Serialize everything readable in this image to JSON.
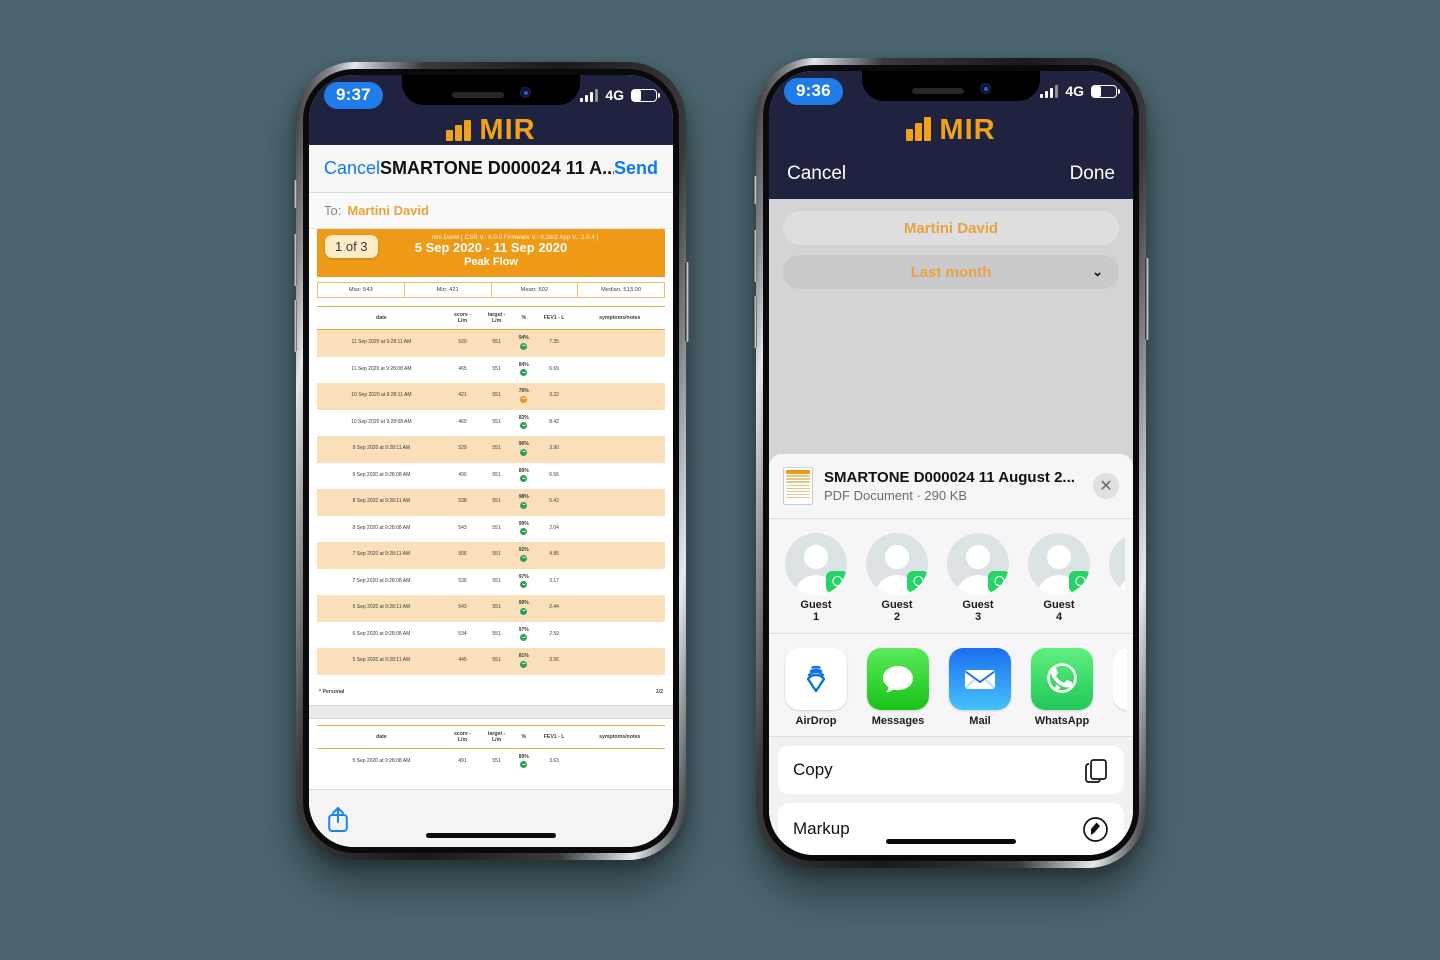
{
  "background_color": "#4b666f",
  "left_phone": {
    "status_bar": {
      "time": "9:37",
      "network": "4G",
      "battery_icon": "battery-icon",
      "signal_icon": "cellular-bars-icon"
    },
    "brand": {
      "word": "MIR",
      "logo_name": "mir-logo-mark",
      "color": "#f0a21c"
    },
    "nav": {
      "cancel": "Cancel",
      "title": "SMARTONE D000024 11 A...",
      "send": "Send"
    },
    "to_field": {
      "label": "To:",
      "value": "Martini David"
    },
    "pdf": {
      "page_badge": "1 of 3",
      "meta": "rtini David  [ CSR V.: 6.0.0 Firmware V.: 0.26r2 App V.: 2.0.4 ]",
      "date_range": "5 Sep 2020 - 11 Sep 2020",
      "test_type": "Peak Flow",
      "stats": [
        "Max: 543",
        "Min: 421",
        "Mean: 502",
        "Median: 513.00"
      ],
      "columns": [
        "date",
        "score - L/m",
        "target - L/m",
        "%",
        "FEV1 - L",
        "symptoms/notes"
      ],
      "rows": [
        {
          "date": "11 Sep 2020 at 9:28:11 AM",
          "score": "520",
          "target": "551",
          "pct": "94%",
          "face": "green",
          "fev1": "7.35",
          "notes": ""
        },
        {
          "date": "11 Sep 2020 at 9:28:08 AM",
          "score": "465",
          "target": "551",
          "pct": "84%",
          "face": "green",
          "fev1": "6.69",
          "notes": ""
        },
        {
          "date": "10 Sep 2020 at 9:28:11 AM",
          "score": "421",
          "target": "551",
          "pct": "76%",
          "face": "orange",
          "fev1": "3.22",
          "notes": ""
        },
        {
          "date": "10 Sep 2020 at 9:28:08 AM",
          "score": "460",
          "target": "551",
          "pct": "83%",
          "face": "green",
          "fev1": "8.42",
          "notes": ""
        },
        {
          "date": "9 Sep 2020 at 9:28:11 AM",
          "score": "529",
          "target": "551",
          "pct": "96%",
          "face": "green",
          "fev1": "3.90",
          "notes": ""
        },
        {
          "date": "9 Sep 2020 at 9:28:08 AM",
          "score": "490",
          "target": "551",
          "pct": "89%",
          "face": "green",
          "fev1": "6.56",
          "notes": ""
        },
        {
          "date": "8 Sep 2020 at 9:28:11 AM",
          "score": "538",
          "target": "551",
          "pct": "98%",
          "face": "green",
          "fev1": "5.42",
          "notes": ""
        },
        {
          "date": "8 Sep 2020 at 9:28:08 AM",
          "score": "543",
          "target": "551",
          "pct": "99%",
          "face": "green",
          "fev1": "2.04",
          "notes": ""
        },
        {
          "date": "7 Sep 2020 at 9:28:11 AM",
          "score": "506",
          "target": "551",
          "pct": "92%",
          "face": "green",
          "fev1": "4.85",
          "notes": ""
        },
        {
          "date": "7 Sep 2020 at 9:28:08 AM",
          "score": "536",
          "target": "551",
          "pct": "97%",
          "face": "green",
          "fev1": "3.17",
          "notes": ""
        },
        {
          "date": "6 Sep 2020 at 9:28:11 AM",
          "score": "543",
          "target": "551",
          "pct": "99%",
          "face": "green",
          "fev1": "2.44",
          "notes": ""
        },
        {
          "date": "6 Sep 2020 at 9:28:08 AM",
          "score": "534",
          "target": "551",
          "pct": "97%",
          "face": "green",
          "fev1": "2.59",
          "notes": ""
        },
        {
          "date": "5 Sep 2020 at 9:28:11 AM",
          "score": "445",
          "target": "551",
          "pct": "81%",
          "face": "green",
          "fev1": "3.56",
          "notes": ""
        }
      ],
      "footnote": "* Personal",
      "page_number": "1/2",
      "page2_rows": [
        {
          "date": "5 Sep 2020 at 9:28:08 AM",
          "score": "491",
          "target": "551",
          "pct": "89%",
          "face": "green",
          "fev1": "3.63",
          "notes": ""
        }
      ]
    },
    "toolbar": {
      "share_icon": "share-icon"
    }
  },
  "right_phone": {
    "status_bar": {
      "time": "9:36",
      "network": "4G",
      "battery_icon": "battery-icon",
      "signal_icon": "cellular-bars-icon"
    },
    "brand": {
      "word": "MIR",
      "logo_name": "mir-logo-mark",
      "color": "#f0a21c"
    },
    "nav": {
      "cancel": "Cancel",
      "done": "Done"
    },
    "fields": [
      {
        "name": "patient-selector",
        "value": "Martini David",
        "has_chevron": false
      },
      {
        "name": "period-selector",
        "value": "Last month",
        "has_chevron": true
      }
    ],
    "share_sheet": {
      "file": {
        "name": "SMARTONE D000024 11 August 2...",
        "subtitle": "PDF Document · 290 KB",
        "close_icon": "close-icon",
        "thumbnail_icon": "pdf-thumbnail-icon"
      },
      "contacts": [
        {
          "name": "Guest\n1",
          "line1": "Guest",
          "line2": "1",
          "app_badge": "whatsapp-icon"
        },
        {
          "name": "Guest\n2",
          "line1": "Guest",
          "line2": "2",
          "app_badge": "whatsapp-icon"
        },
        {
          "name": "Guest\n3",
          "line1": "Guest",
          "line2": "3",
          "app_badge": "whatsapp-icon"
        },
        {
          "name": "Guest\n4",
          "line1": "Guest",
          "line2": "4",
          "app_badge": "whatsapp-icon"
        }
      ],
      "apps": [
        {
          "label": "AirDrop",
          "icon": "airdrop-icon"
        },
        {
          "label": "Messages",
          "icon": "messages-icon"
        },
        {
          "label": "Mail",
          "icon": "mail-icon"
        },
        {
          "label": "WhatsApp",
          "icon": "whatsapp-icon"
        }
      ],
      "actions": [
        {
          "label": "Copy",
          "icon": "copy-icon"
        },
        {
          "label": "Markup",
          "icon": "markup-icon"
        }
      ]
    }
  }
}
